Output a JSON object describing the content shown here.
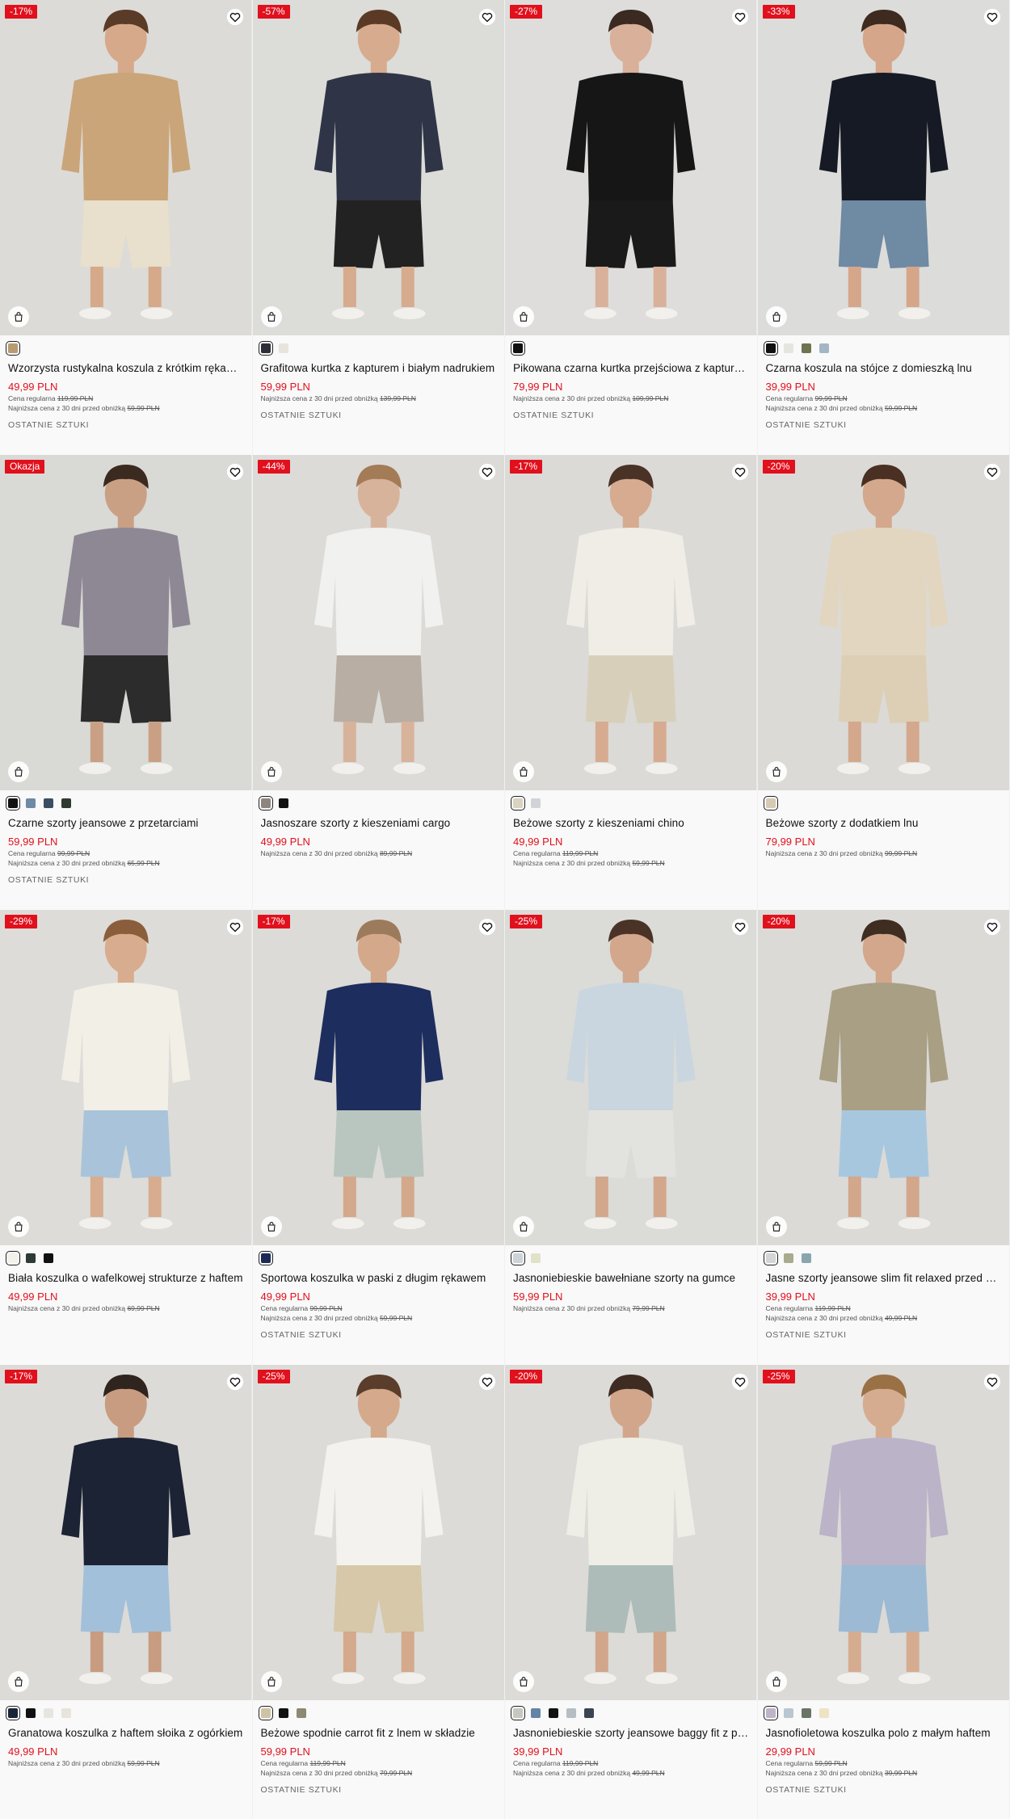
{
  "labels": {
    "regular": "Cena regularna",
    "lowest": "Najniższa cena z 30 dni przed obniżką"
  },
  "products": [
    {
      "badge": "-17%",
      "name": "Wzorzysta rustykalna koszula z krótkim rękawem",
      "price": "49,99 PLN",
      "regular": "119,99 PLN",
      "lowest": "59,99 PLN",
      "status": "OSTATNIE SZTUKI",
      "swatches": [
        "#b89a73"
      ],
      "top": "#caa57a",
      "bottom": "#e8dfcc",
      "skin": "#d6a98a",
      "hair": "#5a3b28",
      "bg": "#dcdbd7"
    },
    {
      "badge": "-57%",
      "name": "Grafitowa kurtka z kapturem i białym nadrukiem",
      "price": "59,99 PLN",
      "regular": "",
      "lowest": "139,99 PLN",
      "status": "OSTATNIE SZTUKI",
      "swatches": [
        "#2d2f36",
        "#e6e4dc"
      ],
      "top": "#2f3546",
      "bottom": "#222",
      "skin": "#d7ab8e",
      "hair": "#5b3a25",
      "bg": "#dcdcd9"
    },
    {
      "badge": "-27%",
      "name": "Pikowana czarna kurtka przejściowa z kapturem",
      "price": "79,99 PLN",
      "regular": "",
      "lowest": "109,99 PLN",
      "status": "OSTATNIE SZTUKI",
      "swatches": [
        "#111"
      ],
      "top": "#161617",
      "bottom": "#1a1a1a",
      "skin": "#d9b09a",
      "hair": "#3a2a21",
      "bg": "#dedddb"
    },
    {
      "badge": "-33%",
      "name": "Czarna koszula na stójce z domieszką lnu",
      "price": "39,99 PLN",
      "regular": "99,99 PLN",
      "lowest": "59,99 PLN",
      "status": "OSTATNIE SZTUKI",
      "swatches": [
        "#111",
        "#e5e4df",
        "#6f7450",
        "#a4b6c5"
      ],
      "top": "#161a24",
      "bottom": "#6f8aa3",
      "skin": "#d5a68a",
      "hair": "#3e2a1e",
      "bg": "#dcdcda"
    },
    {
      "badge": "Okazja",
      "name": "Czarne szorty jeansowe z przetarciami",
      "price": "59,99 PLN",
      "regular": "99,99 PLN",
      "lowest": "65,99 PLN",
      "status": "OSTATNIE SZTUKI",
      "swatches": [
        "#111",
        "#6d8aa6",
        "#3b4d63",
        "#2f3a33"
      ],
      "top": "#8e8895",
      "bottom": "#2c2c2c",
      "skin": "#caa084",
      "hair": "#3b2a20",
      "bg": "#d9d9d6"
    },
    {
      "badge": "-44%",
      "name": "Jasnoszare szorty z kieszeniami cargo",
      "price": "49,99 PLN",
      "regular": "",
      "lowest": "89,99 PLN",
      "status": "",
      "swatches": [
        "#8d857e",
        "#111"
      ],
      "top": "#f1f1ef",
      "bottom": "#b8aea3",
      "skin": "#d8b39b",
      "hair": "#a47b57",
      "bg": "#dcdbd8"
    },
    {
      "badge": "-17%",
      "name": "Beżowe szorty z kieszeniami chino",
      "price": "49,99 PLN",
      "regular": "119,99 PLN",
      "lowest": "59,99 PLN",
      "status": "",
      "swatches": [
        "#d9d3bf",
        "#d0d3d8"
      ],
      "top": "#efede6",
      "bottom": "#d8cfbb",
      "skin": "#d6ab90",
      "hair": "#4a3226",
      "bg": "#dbdad7"
    },
    {
      "badge": "-20%",
      "name": "Beżowe szorty z dodatkiem lnu",
      "price": "79,99 PLN",
      "regular": "",
      "lowest": "99,99 PLN",
      "status": "",
      "swatches": [
        "#d5cbb3"
      ],
      "top": "#e2d6c0",
      "bottom": "#dccfb6",
      "skin": "#d3a88c",
      "hair": "#4a3022",
      "bg": "#dbdad7"
    },
    {
      "badge": "-29%",
      "name": "Biała koszulka o wafelkowej strukturze z haftem",
      "price": "49,99 PLN",
      "regular": "",
      "lowest": "69,99 PLN",
      "status": "",
      "swatches": [
        "#f3f1ea",
        "#2e3a35",
        "#111"
      ],
      "top": "#f2efe6",
      "bottom": "#a9c4da",
      "skin": "#d8ac8f",
      "hair": "#8a5e3b",
      "bg": "#dedcd8"
    },
    {
      "badge": "-17%",
      "name": "Sportowa koszulka w paski z długim rękawem",
      "price": "49,99 PLN",
      "regular": "99,99 PLN",
      "lowest": "59,99 PLN",
      "status": "OSTATNIE SZTUKI",
      "swatches": [
        "#1c2a55"
      ],
      "top": "#1d2d5e",
      "bottom": "#b9c6bf",
      "skin": "#d4a88b",
      "hair": "#9c7b5c",
      "bg": "#dcdbd7"
    },
    {
      "badge": "-25%",
      "name": "Jasnoniebieskie bawełniane szorty na gumce",
      "price": "59,99 PLN",
      "regular": "",
      "lowest": "79,99 PLN",
      "status": "",
      "swatches": [
        "#cdd3d6",
        "#e1e3c9"
      ],
      "top": "#c9d6df",
      "bottom": "#e2e2de",
      "skin": "#d2a78c",
      "hair": "#4a3326",
      "bg": "#dbdbd8"
    },
    {
      "badge": "-20%",
      "name": "Jasne szorty jeansowe slim fit relaxed przed kolano",
      "price": "39,99 PLN",
      "regular": "119,99 PLN",
      "lowest": "49,99 PLN",
      "status": "OSTATNIE SZTUKI",
      "swatches": [
        "#d3d5d6",
        "#a9ab8e",
        "#8aa6ad"
      ],
      "top": "#a89f84",
      "bottom": "#a7c7df",
      "skin": "#d3a78b",
      "hair": "#3f2d22",
      "bg": "#dbdad7"
    },
    {
      "badge": "-17%",
      "name": "Granatowa koszulka z haftem słoika z ogórkiem",
      "price": "49,99 PLN",
      "regular": "",
      "lowest": "59,99 PLN",
      "status": "",
      "swatches": [
        "#1a2538",
        "#111",
        "#e6e6e1",
        "#e7e4dc"
      ],
      "top": "#1b2334",
      "bottom": "#a3c0da",
      "skin": "#c89c80",
      "hair": "#2f241e",
      "bg": "#dcdbd8"
    },
    {
      "badge": "-25%",
      "name": "Beżowe spodnie carrot fit z lnem w składzie",
      "price": "59,99 PLN",
      "regular": "119,99 PLN",
      "lowest": "79,99 PLN",
      "status": "OSTATNIE SZTUKI",
      "swatches": [
        "#cfc3a6",
        "#111",
        "#8c8a72"
      ],
      "top": "#f3f2ee",
      "bottom": "#d6c8a8",
      "skin": "#d4a98c",
      "hair": "#5a3d2a",
      "bg": "#dcdbd8"
    },
    {
      "badge": "-20%",
      "name": "Jasnoniebieskie szorty jeansowe baggy fit z przetarciami",
      "price": "39,99 PLN",
      "regular": "119,99 PLN",
      "lowest": "49,99 PLN",
      "status": "",
      "swatches": [
        "#c5c8bf",
        "#6385a4",
        "#111",
        "#b6bec3",
        "#3b4552"
      ],
      "top": "#eeede6",
      "bottom": "#aebcb9",
      "skin": "#d1a68b",
      "hair": "#3e2c22",
      "bg": "#dcdbd8"
    },
    {
      "badge": "-25%",
      "name": "Jasnofioletowa koszulka polo z małym haftem",
      "price": "29,99 PLN",
      "regular": "59,99 PLN",
      "lowest": "39,99 PLN",
      "status": "OSTATNIE SZTUKI",
      "swatches": [
        "#bdb5c7",
        "#b9c7d0",
        "#6a7466",
        "#efe3c6"
      ],
      "top": "#bbb3c8",
      "bottom": "#9cbad4",
      "skin": "#d6ac90",
      "hair": "#9a7045",
      "bg": "#dbdad7"
    }
  ]
}
